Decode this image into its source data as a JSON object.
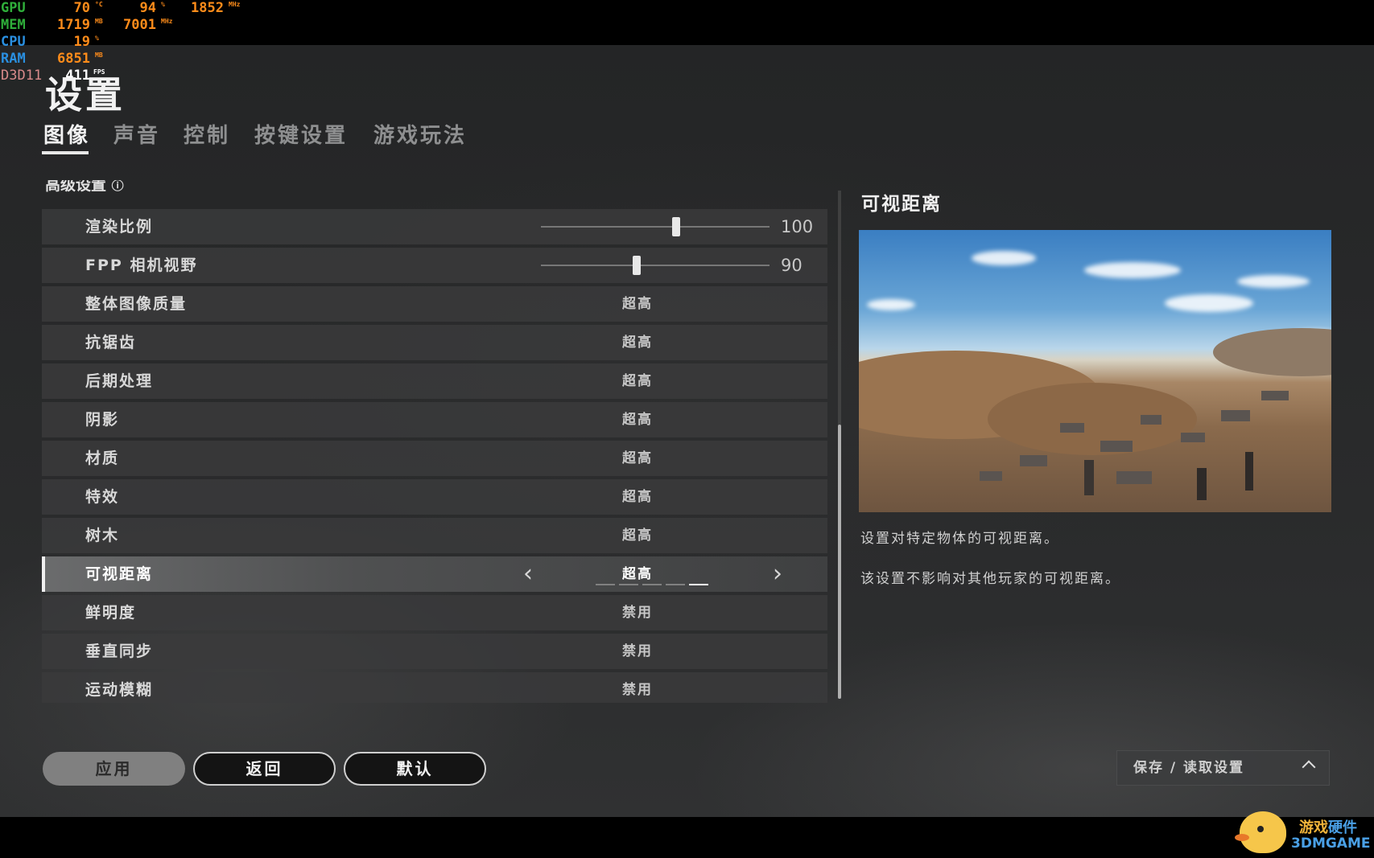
{
  "osd": {
    "gpu": {
      "key": "GPU",
      "temp": "70",
      "temp_unit": "°C",
      "load": "94",
      "load_unit": "%",
      "clock": "1852",
      "clock_unit": "MHz"
    },
    "mem": {
      "key": "MEM",
      "used": "1719",
      "used_unit": "MB",
      "clock": "7001",
      "clock_unit": "MHz"
    },
    "cpu": {
      "key": "CPU",
      "load": "19",
      "load_unit": "%"
    },
    "ram": {
      "key": "RAM",
      "used": "6851",
      "used_unit": "MB"
    },
    "d3d": {
      "key": "D3D11",
      "fps": "411",
      "fps_unit": "FPS"
    }
  },
  "page": {
    "title": "设置"
  },
  "tabs": [
    {
      "label": "图像",
      "active": true
    },
    {
      "label": "声音",
      "active": false
    },
    {
      "label": "控制",
      "active": false
    },
    {
      "label": "按键设置",
      "active": false
    },
    {
      "label": "游戏玩法",
      "active": false
    }
  ],
  "section": {
    "title": "高级设置",
    "info_icon": "info-circle-icon"
  },
  "settings": [
    {
      "label": "渲染比例",
      "type": "slider",
      "value": "100",
      "fraction": 0.59
    },
    {
      "label": "FPP 相机视野",
      "type": "slider",
      "value": "90",
      "fraction": 0.42
    },
    {
      "label": "整体图像质量",
      "type": "option",
      "value": "超高"
    },
    {
      "label": "抗锯齿",
      "type": "option",
      "value": "超高"
    },
    {
      "label": "后期处理",
      "type": "option",
      "value": "超高"
    },
    {
      "label": "阴影",
      "type": "option",
      "value": "超高"
    },
    {
      "label": "材质",
      "type": "option",
      "value": "超高"
    },
    {
      "label": "特效",
      "type": "option",
      "value": "超高"
    },
    {
      "label": "树木",
      "type": "option",
      "value": "超高"
    },
    {
      "label": "可视距离",
      "type": "option",
      "value": "超高",
      "selected": true,
      "level": 5,
      "levels": 5
    },
    {
      "label": "鲜明度",
      "type": "option",
      "value": "禁用"
    },
    {
      "label": "垂直同步",
      "type": "option",
      "value": "禁用"
    },
    {
      "label": "运动模糊",
      "type": "option",
      "value": "禁用"
    }
  ],
  "info": {
    "title": "可视距离",
    "line1": "设置对特定物体的可视距离。",
    "line2": "该设置不影响对其他玩家的可视距离。"
  },
  "buttons": {
    "apply": "应用",
    "back": "返回",
    "default": "默认"
  },
  "save_load": {
    "label": "保存 / 读取设置",
    "icon": "chevron-up-icon"
  },
  "watermark": {
    "cn_a": "游戏",
    "cn_b": "硬件",
    "en": "3DMGAME"
  }
}
